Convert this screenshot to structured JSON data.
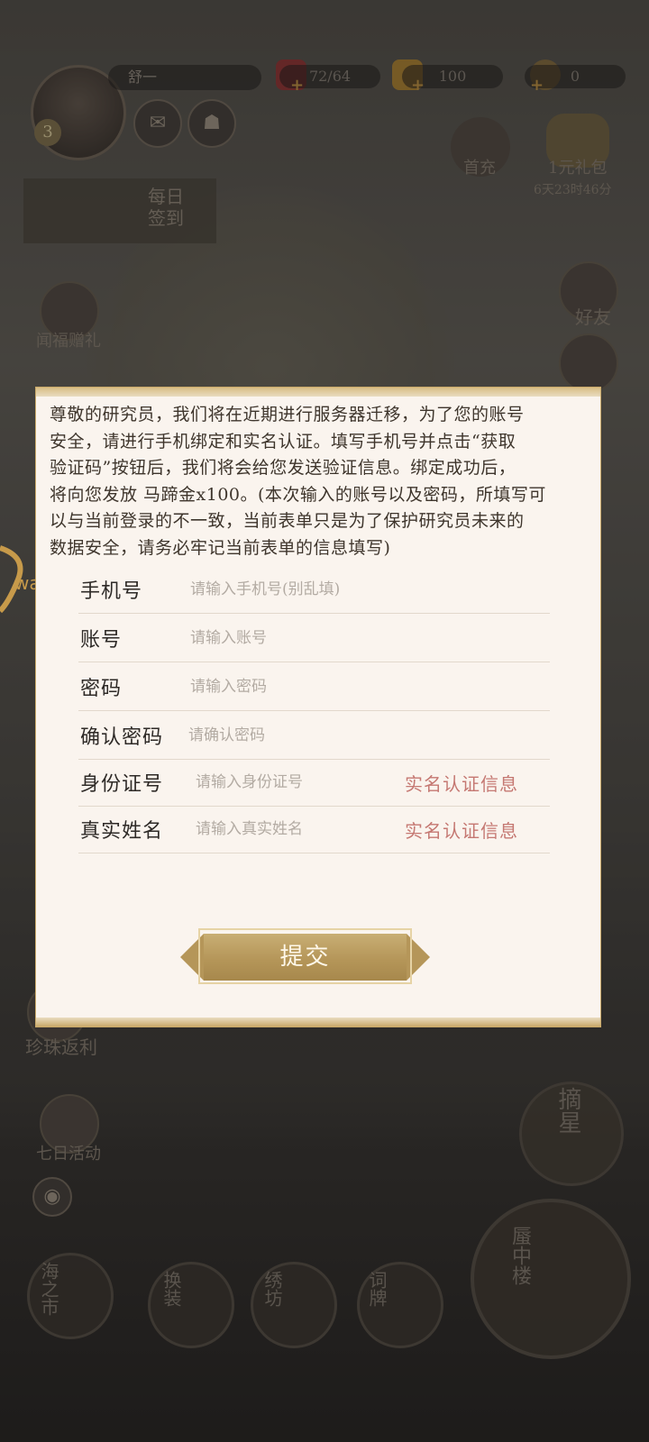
{
  "hud": {
    "player_name": "舒一",
    "level": "3",
    "resources": [
      {
        "name": "stamina",
        "value": "72/64",
        "icon": "gem-heart-icon",
        "color": "#b34b4b"
      },
      {
        "name": "gold",
        "value": "100",
        "icon": "gold-ingot-icon",
        "color": "#d7a542"
      },
      {
        "name": "coin",
        "value": "0",
        "icon": "coin-icon",
        "color": "#c9a35a"
      }
    ],
    "first_recharge_label": "首充",
    "gift_label": "1元礼包",
    "gift_timer": "6天23时46分",
    "daily_signin": "每日签到",
    "invite_gift": "闻福赠礼",
    "friends_label": "好友",
    "pearl_rebate": "珍珠返利",
    "seven_day": "七日活动",
    "star_pick": "摘星"
  },
  "bottom_nav": [
    {
      "label": "海之市"
    },
    {
      "label": "换装"
    },
    {
      "label": "绣坊"
    },
    {
      "label": "词牌"
    },
    {
      "label": "蜃中楼"
    }
  ],
  "modal": {
    "notice_lines": [
      "尊敬的研究员，我们将在近期进行服务器迁移，为了您的账号",
      "安全，请进行手机绑定和实名认证。填写手机号并点击“获取",
      "验证码”按钮后，我们将会给您发送验证信息。绑定成功后，",
      "将向您发放 马蹄金x100。(本次输入的账号以及密码，所填写可",
      "以与当前登录的不一致，当前表单只是为了保护研究员未来的",
      "数据安全，请务必牢记当前表单的信息填写)"
    ],
    "fields": [
      {
        "label": "手机号",
        "placeholder": "请输入手机号(别乱填)"
      },
      {
        "label": "账号",
        "placeholder": "请输入账号"
      },
      {
        "label": "密码",
        "placeholder": "请输入密码"
      },
      {
        "label": "确认密码",
        "placeholder": "请确认密码"
      },
      {
        "label": "身份证号",
        "placeholder": "请输入身份证号",
        "tag": "实名认证信息"
      },
      {
        "label": "真实姓名",
        "placeholder": "请输入真实姓名",
        "tag": "实名认证信息"
      }
    ],
    "submit_label": "提交"
  },
  "logo_text": "wan"
}
